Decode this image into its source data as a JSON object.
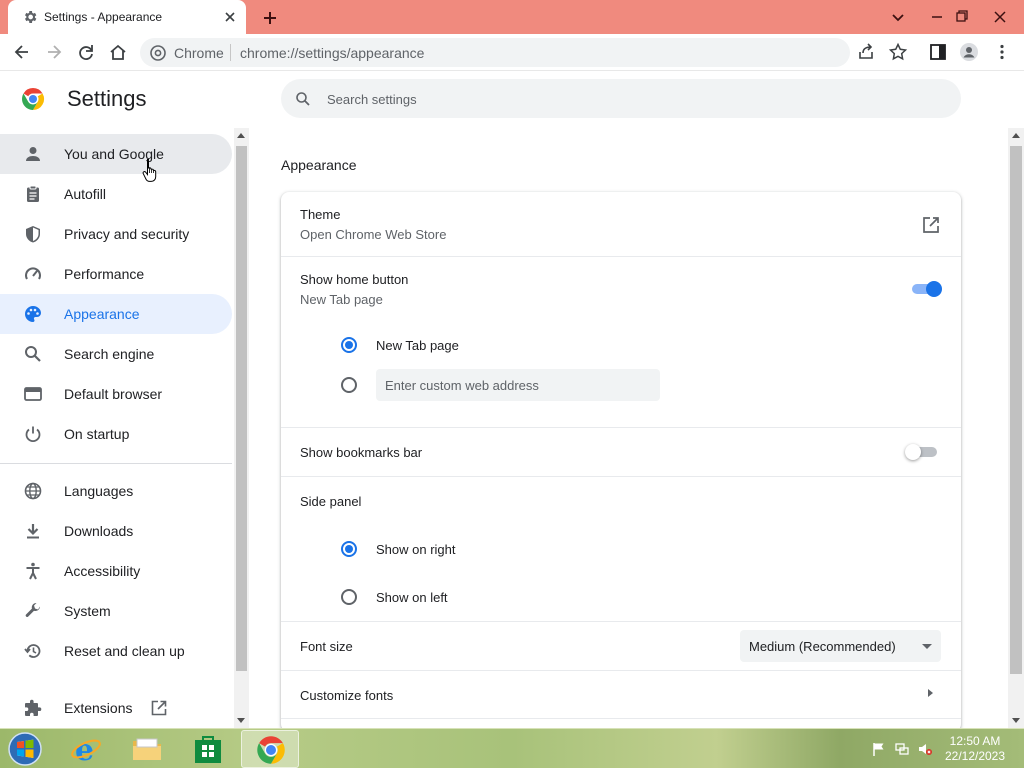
{
  "browser": {
    "tab_title": "Settings - Appearance",
    "site_chip": "Chrome",
    "url": "chrome://settings/appearance"
  },
  "settings": {
    "title": "Settings",
    "search_placeholder": "Search settings"
  },
  "sidebar": {
    "items": [
      {
        "label": "You and Google",
        "icon": "person-icon",
        "state": "hover"
      },
      {
        "label": "Autofill",
        "icon": "clipboard-icon"
      },
      {
        "label": "Privacy and security",
        "icon": "shield-icon"
      },
      {
        "label": "Performance",
        "icon": "speedometer-icon"
      },
      {
        "label": "Appearance",
        "icon": "palette-icon",
        "state": "active"
      },
      {
        "label": "Search engine",
        "icon": "search-icon"
      },
      {
        "label": "Default browser",
        "icon": "browser-window-icon"
      },
      {
        "label": "On startup",
        "icon": "power-icon"
      },
      {
        "label": "Languages",
        "icon": "globe-icon"
      },
      {
        "label": "Downloads",
        "icon": "download-icon"
      },
      {
        "label": "Accessibility",
        "icon": "accessibility-icon"
      },
      {
        "label": "System",
        "icon": "wrench-icon"
      },
      {
        "label": "Reset and clean up",
        "icon": "restore-icon"
      },
      {
        "label": "Extensions",
        "icon": "puzzle-icon"
      }
    ]
  },
  "appearance": {
    "section_title": "Appearance",
    "theme": {
      "title": "Theme",
      "subtitle": "Open Chrome Web Store"
    },
    "home_button": {
      "title": "Show home button",
      "subtitle": "New Tab page",
      "enabled": true,
      "option_newtab": "New Tab page",
      "custom_placeholder": "Enter custom web address",
      "selected": "newtab"
    },
    "bookmarks_bar": {
      "title": "Show bookmarks bar",
      "enabled": false
    },
    "side_panel": {
      "title": "Side panel",
      "option_right": "Show on right",
      "option_left": "Show on left",
      "selected": "right"
    },
    "font_size": {
      "title": "Font size",
      "value": "Medium (Recommended)"
    },
    "customize_fonts": {
      "title": "Customize fonts"
    }
  },
  "taskbar": {
    "time": "12:50 AM",
    "date": "22/12/2023"
  },
  "colors": {
    "accent": "#1a73e8",
    "titlebar": "#f08a7e"
  }
}
